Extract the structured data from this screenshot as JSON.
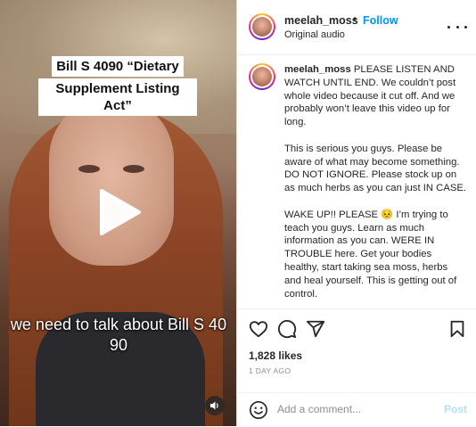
{
  "video": {
    "caption_lines": [
      "Bill S 4090 “Dietary",
      "Supplement Listing Act”"
    ],
    "subtitle": "we need to talk about Bill S 40 90",
    "play_icon": "play-icon",
    "mute_icon": "speaker-icon"
  },
  "header": {
    "username": "meelah_moss",
    "separator": "•",
    "follow_label": "Follow",
    "audio_label": "Original audio",
    "more_icon": "more-options-icon"
  },
  "caption": {
    "username": "meelah_moss",
    "paragraphs": [
      "PLEASE LISTEN AND WATCH UNTIL END. We couldn’t post whole video because it cut off. And we probably won’t leave this video up for long.",
      "This is serious you guys. Please be aware of what may become something. DO NOT IGNORE. Please stock up on as much herbs as you can just IN CASE.",
      "WAKE UP!! PLEASE 😣 I’m trying to teach you guys. Learn as much information as you can. WERE IN TROUBLE here. Get your bodies healthy, start taking sea moss, herbs and heal yourself. This is getting out of control."
    ]
  },
  "actions": {
    "icons": [
      "heart-icon",
      "comment-icon",
      "share-icon",
      "bookmark-icon"
    ]
  },
  "likes": "1,828 likes",
  "time_ago": "1 DAY AGO",
  "add_comment": {
    "placeholder": "Add a comment...",
    "post_label": "Post",
    "emoji_icon": "emoji-icon"
  },
  "colors": {
    "accent": "#0095f6",
    "post_disabled": "#b2dffc",
    "muted_text": "#8e8e8e"
  }
}
